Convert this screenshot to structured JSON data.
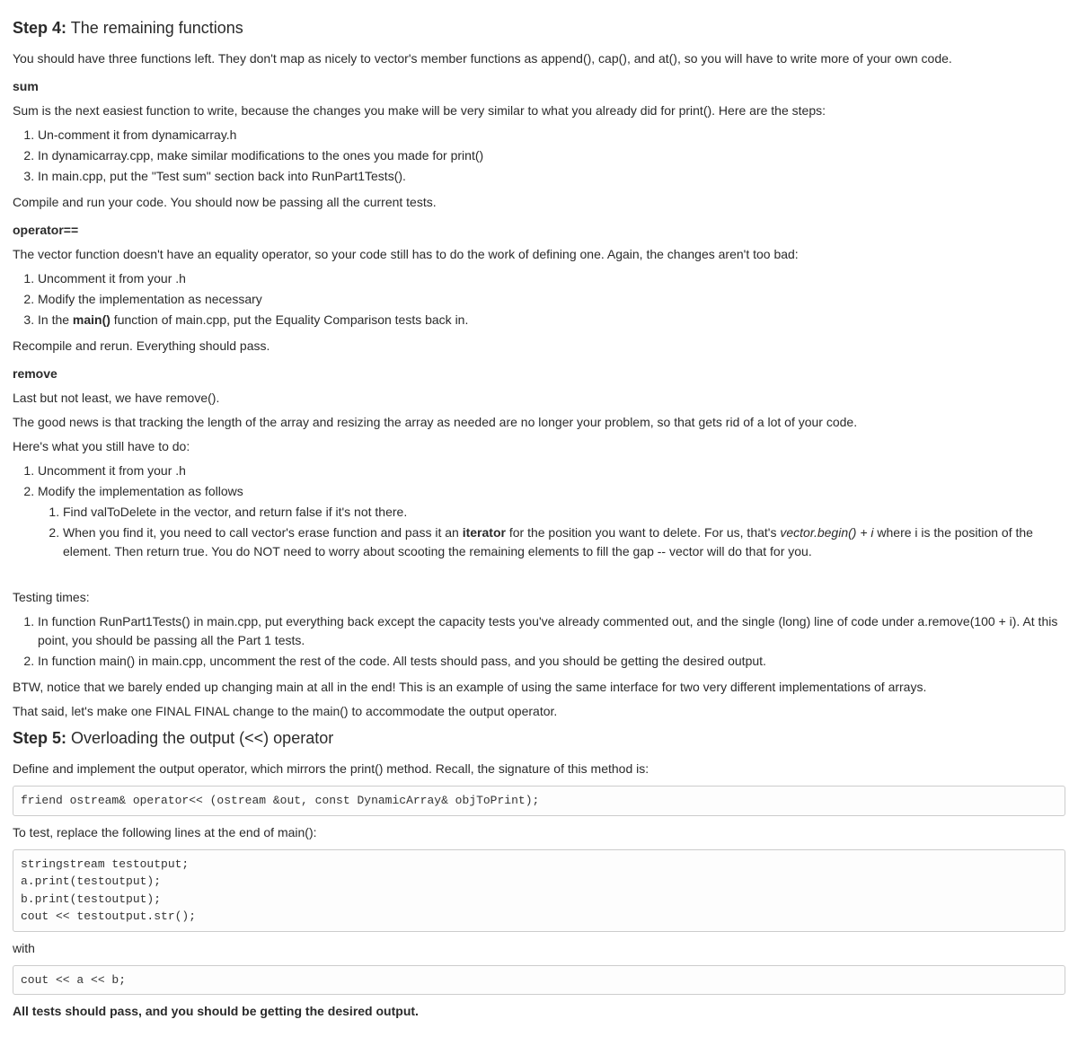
{
  "step4": {
    "label": "Step 4:",
    "title": "The remaining functions",
    "intro": "You should have three functions left. They don't map as nicely to vector's member functions as append(), cap(), and at(), so you will have to write more of your own code.",
    "sum": {
      "heading": "sum",
      "p1": "Sum is the next easiest function to write, because the changes you make will be very similar to what you already did for print(). Here are the steps:",
      "ol1": [
        "Un-comment it from dynamicarray.h",
        "In dynamicarray.cpp, make similar modifications to the ones you made for print()",
        "In main.cpp, put the \"Test sum\" section back into RunPart1Tests()."
      ],
      "p2": "Compile and run your code. You should now be passing all the current tests."
    },
    "operator": {
      "heading": "operator==",
      "p1": "The vector function doesn't have an equality operator, so your code still has to do the work of defining one. Again, the changes aren't too bad:",
      "ol1": {
        "i1": "Uncomment it from your .h",
        "i2": "Modify the implementation as necessary",
        "i3_pre": "In the ",
        "i3_bold": "main()",
        "i3_post": " function of main.cpp, put the Equality Comparison tests back in."
      },
      "p2": "Recompile and rerun. Everything should pass."
    },
    "remove": {
      "heading": "remove",
      "p1": "Last but not least, we have remove().",
      "p2": "The good news is that tracking the length of the array and resizing the array as needed are no longer your problem, so that gets rid of a lot of your code.",
      "p3": "Here's what you still have to do:",
      "ol1": {
        "i1": "Uncomment it from your .h",
        "i2": "Modify the implementation as follows",
        "sub1": "Find valToDelete in the vector, and return false if it's not there.",
        "sub2_pre": "When you find it, you need to call vector's erase function and pass it an ",
        "sub2_b": "iterator",
        "sub2_mid": " for the position you want to delete. For us, that's ",
        "sub2_it": "vector.begin() + i",
        "sub2_post": " where i is the position of the element. Then return true. You do NOT need to worry about scooting the remaining elements to fill the gap -- vector will do that for you."
      }
    },
    "testing": {
      "heading": "Testing times:",
      "ol1": [
        "In function RunPart1Tests() in main.cpp, put everything back except the capacity tests you've already commented out, and the single (long) line of code under a.remove(100 + i). At this point, you should be passing all the Part 1 tests.",
        "In function main() in main.cpp, uncomment the rest of the code. All tests should pass, and you should be getting the desired output."
      ],
      "p1": "BTW, notice that we barely ended up changing main at all in the end! This is an example of using the same interface for two very different implementations of arrays.",
      "p2": "That said, let's make one FINAL FINAL change to the main() to accommodate the output operator."
    }
  },
  "step5": {
    "label": "Step 5:",
    "title": "Overloading the output (<<) operator",
    "p1": "Define and implement the output operator, which mirrors the print() method. Recall, the signature of this method is:",
    "code1": "friend ostream& operator<< (ostream &out, const DynamicArray& objToPrint);",
    "p2": "To test, replace the following lines at the end of main():",
    "code2": "stringstream testoutput;\na.print(testoutput);\nb.print(testoutput);\ncout << testoutput.str();",
    "p3": "with",
    "code3": "cout << a << b;",
    "p4": "All tests should pass, and you should be getting the desired output."
  }
}
